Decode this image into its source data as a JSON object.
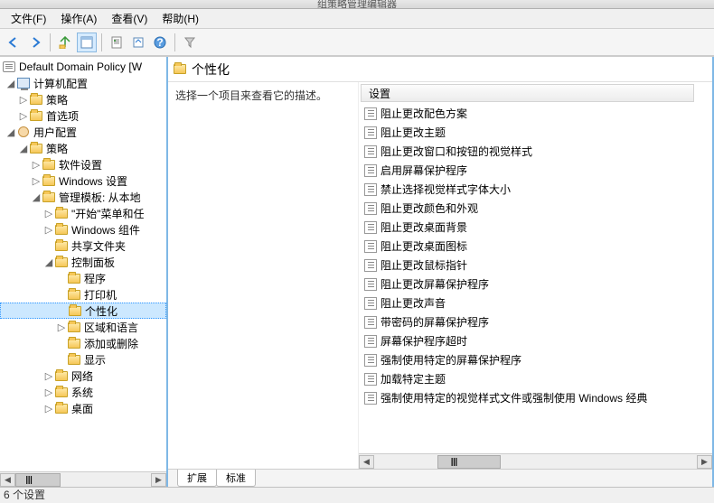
{
  "title_fragment": "组策略管理编辑器",
  "menu": {
    "file": "文件(F)",
    "action": "操作(A)",
    "view": "查看(V)",
    "help": "帮助(H)"
  },
  "tree": {
    "root": "Default Domain Policy [W",
    "computer_config": "计算机配置",
    "policies1": "策略",
    "prefs1": "首选项",
    "user_config": "用户配置",
    "policies2": "策略",
    "soft_settings": "软件设置",
    "win_settings": "Windows 设置",
    "admin_templates": "管理模板: 从本地",
    "start_menu": "\"开始\"菜单和任",
    "win_components": "Windows 组件",
    "shared_folders": "共享文件夹",
    "control_panel": "控制面板",
    "programs": "程序",
    "printers": "打印机",
    "personalization": "个性化",
    "region_lang": "区域和语言",
    "add_remove": "添加或删除",
    "display": "显示",
    "network": "网络",
    "system": "系统",
    "desktop": "桌面"
  },
  "right": {
    "header": "个性化",
    "desc": "选择一个项目来查看它的描述。",
    "col_settings": "设置",
    "items": [
      "阻止更改配色方案",
      "阻止更改主题",
      "阻止更改窗口和按钮的视觉样式",
      "启用屏幕保护程序",
      "禁止选择视觉样式字体大小",
      "阻止更改颜色和外观",
      "阻止更改桌面背景",
      "阻止更改桌面图标",
      "阻止更改鼠标指针",
      "阻止更改屏幕保护程序",
      "阻止更改声音",
      "带密码的屏幕保护程序",
      "屏幕保护程序超时",
      "强制使用特定的屏幕保护程序",
      "加载特定主题",
      "强制使用特定的视觉样式文件或强制使用 Windows 经典"
    ]
  },
  "tabs": {
    "extended": "扩展",
    "standard": "标准"
  },
  "status": "6 个设置"
}
